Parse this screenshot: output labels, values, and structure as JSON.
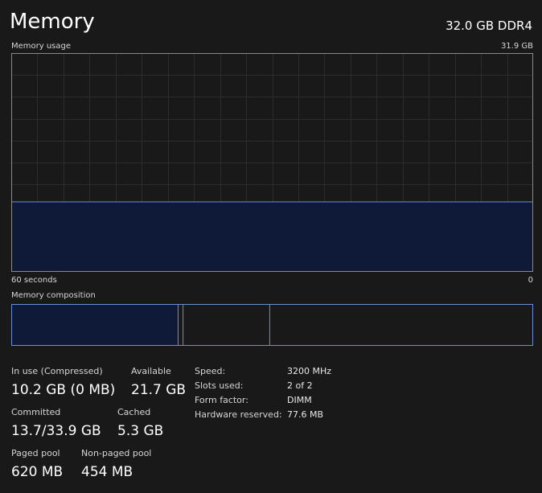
{
  "header": {
    "title": "Memory",
    "hardware": "32.0 GB DDR4"
  },
  "usage_graph": {
    "label": "Memory usage",
    "max_label": "31.9 GB",
    "time_label": "60 seconds",
    "min_label": "0",
    "total_gb": 31.9,
    "usage_gb": [
      10.2,
      10.2,
      10.2,
      10.2,
      10.2,
      10.2,
      10.2,
      10.2,
      10.2,
      10.2,
      10.2,
      10.2,
      10.2,
      10.2,
      10.2,
      10.2,
      10.2,
      10.2,
      10.2,
      10.2,
      10.2,
      10.2,
      10.2,
      10.2,
      10.2,
      10.2,
      10.2,
      10.2,
      10.2,
      10.2,
      10.2,
      10.2,
      10.2,
      10.2,
      10.2,
      10.2,
      10.2,
      10.2,
      10.2,
      10.2,
      10.2,
      10.2,
      10.2,
      10.2,
      10.2,
      10.2,
      10.2,
      10.2,
      10.2,
      10.2,
      10.2,
      10.2,
      10.2,
      10.2,
      10.2,
      10.2,
      10.2,
      10.2,
      10.2,
      10.2,
      10.2
    ],
    "colors": {
      "line": "#6b8fd6",
      "fill": "#0e1a38",
      "grid": "#2c2c2c",
      "border": "#8a8a8a"
    }
  },
  "composition": {
    "label": "Memory composition",
    "segments_gb": {
      "in_use": 10.2,
      "modified": 0.3,
      "standby": 5.3,
      "free": 16.1
    },
    "total_gb": 31.9,
    "colors": {
      "in_use_fill": "#0e1a38",
      "divider": "#6b8fd6",
      "border": "#6b8fd6"
    }
  },
  "stats": {
    "in_use": {
      "label": "In use (Compressed)",
      "value": "10.2 GB (0 MB)"
    },
    "available": {
      "label": "Available",
      "value": "21.7 GB"
    },
    "committed": {
      "label": "Committed",
      "value": "13.7/33.9 GB"
    },
    "cached": {
      "label": "Cached",
      "value": "5.3 GB"
    },
    "paged_pool": {
      "label": "Paged pool",
      "value": "620 MB"
    },
    "non_paged_pool": {
      "label": "Non-paged pool",
      "value": "454 MB"
    }
  },
  "specs": [
    {
      "key": "Speed:",
      "value": "3200 MHz"
    },
    {
      "key": "Slots used:",
      "value": "2 of 2"
    },
    {
      "key": "Form factor:",
      "value": "DIMM"
    },
    {
      "key": "Hardware reserved:",
      "value": "77.6 MB"
    }
  ]
}
